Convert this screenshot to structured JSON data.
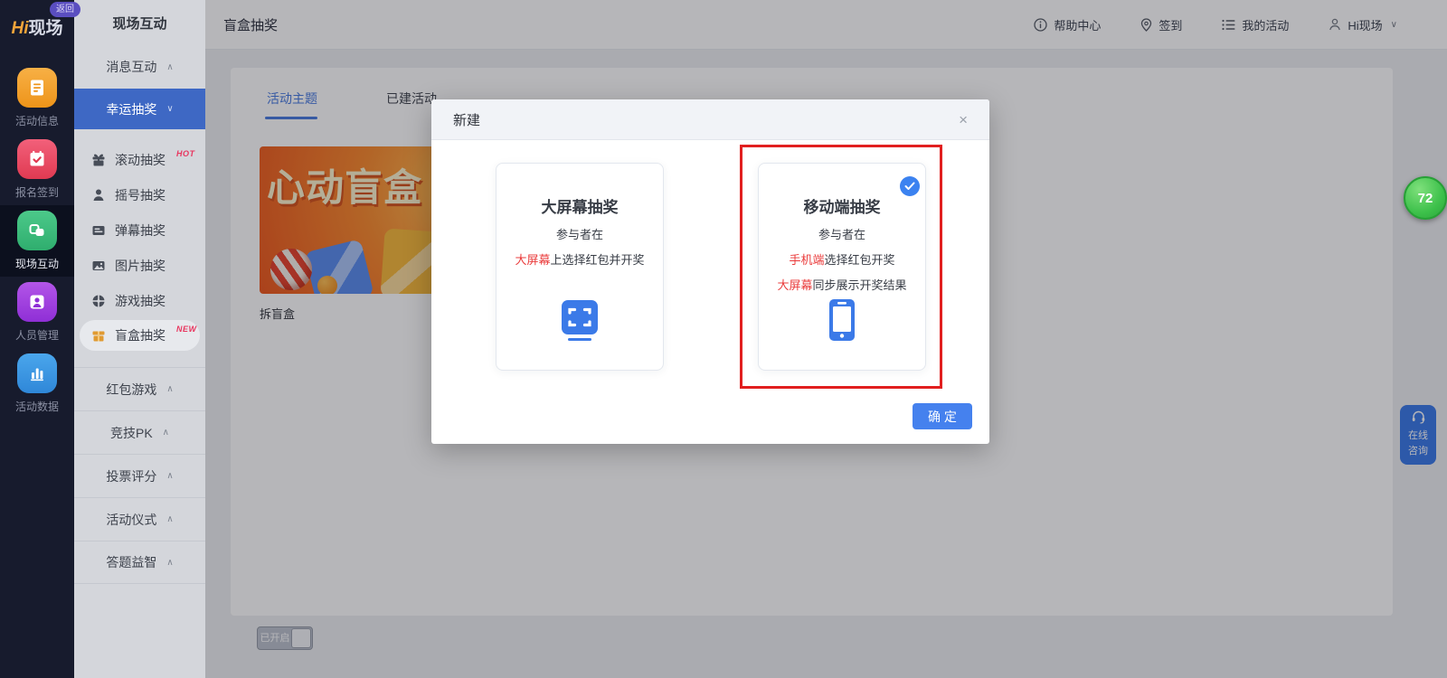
{
  "brand": {
    "logo_hi": "Hi",
    "logo_rest": "现场",
    "back_badge": "返回"
  },
  "rail": {
    "items": [
      {
        "label": "活动信息",
        "icon": "document-icon"
      },
      {
        "label": "报名签到",
        "icon": "calendar-check-icon"
      },
      {
        "label": "现场互动",
        "icon": "interaction-icon",
        "active": true
      },
      {
        "label": "人员管理",
        "icon": "person-badge-icon"
      },
      {
        "label": "活动数据",
        "icon": "bar-chart-icon"
      }
    ]
  },
  "menu": {
    "title": "现场互动",
    "collapsed_top": {
      "label": "消息互动"
    },
    "active_group": {
      "label": "幸运抽奖"
    },
    "submenu": [
      {
        "label": "滚动抽奖",
        "tag": "HOT",
        "icon": "gift-icon"
      },
      {
        "label": "摇号抽奖",
        "tag": "",
        "icon": "person-icon"
      },
      {
        "label": "弹幕抽奖",
        "tag": "",
        "icon": "danmaku-icon"
      },
      {
        "label": "图片抽奖",
        "tag": "",
        "icon": "image-icon"
      },
      {
        "label": "游戏抽奖",
        "tag": "",
        "icon": "game-wheel-icon"
      },
      {
        "label": "盲盒抽奖",
        "tag": "NEW",
        "icon": "blind-box-icon",
        "selected": true
      }
    ],
    "groups": [
      "红包游戏",
      "竞技PK",
      "投票评分",
      "活动仪式",
      "答题益智"
    ]
  },
  "topbar": {
    "title": "盲盒抽奖",
    "help": "帮助中心",
    "checkin": "签到",
    "my_activities": "我的活动",
    "account": "Hi现场"
  },
  "content": {
    "tabs": [
      {
        "label": "活动主题",
        "active": true
      },
      {
        "label": "已建活动"
      }
    ],
    "theme_card": {
      "image_title": "心动盲盒",
      "label": "拆盲盒"
    },
    "toggle_label": "已开启"
  },
  "modal": {
    "title": "新建",
    "close": "×",
    "confirm": "确 定",
    "options": [
      {
        "title": "大屏幕抽奖",
        "line1": "参与者在",
        "line2_red": "大屏幕",
        "line2_rest": "上选择红包并开奖"
      },
      {
        "title": "移动端抽奖",
        "line1": "参与者在",
        "line2_red": "手机端",
        "line2_rest": "选择红包开奖",
        "line3_red": "大屏幕",
        "line3_rest": "同步展示开奖结果",
        "selected": true
      }
    ]
  },
  "floating": {
    "badge_number": "72",
    "service_line1": "在线",
    "service_line2": "咨询"
  },
  "colors": {
    "accent_blue": "#4a7be0",
    "menu_active_blue": "#3e68c4",
    "danger_red": "#ea3b3b",
    "annotation_red": "#e11f1f",
    "confirm_blue": "#4581ee",
    "badge_green": "#3cc04a",
    "tag_pink": "#e8365f",
    "rail_bg": "#171b2d"
  }
}
